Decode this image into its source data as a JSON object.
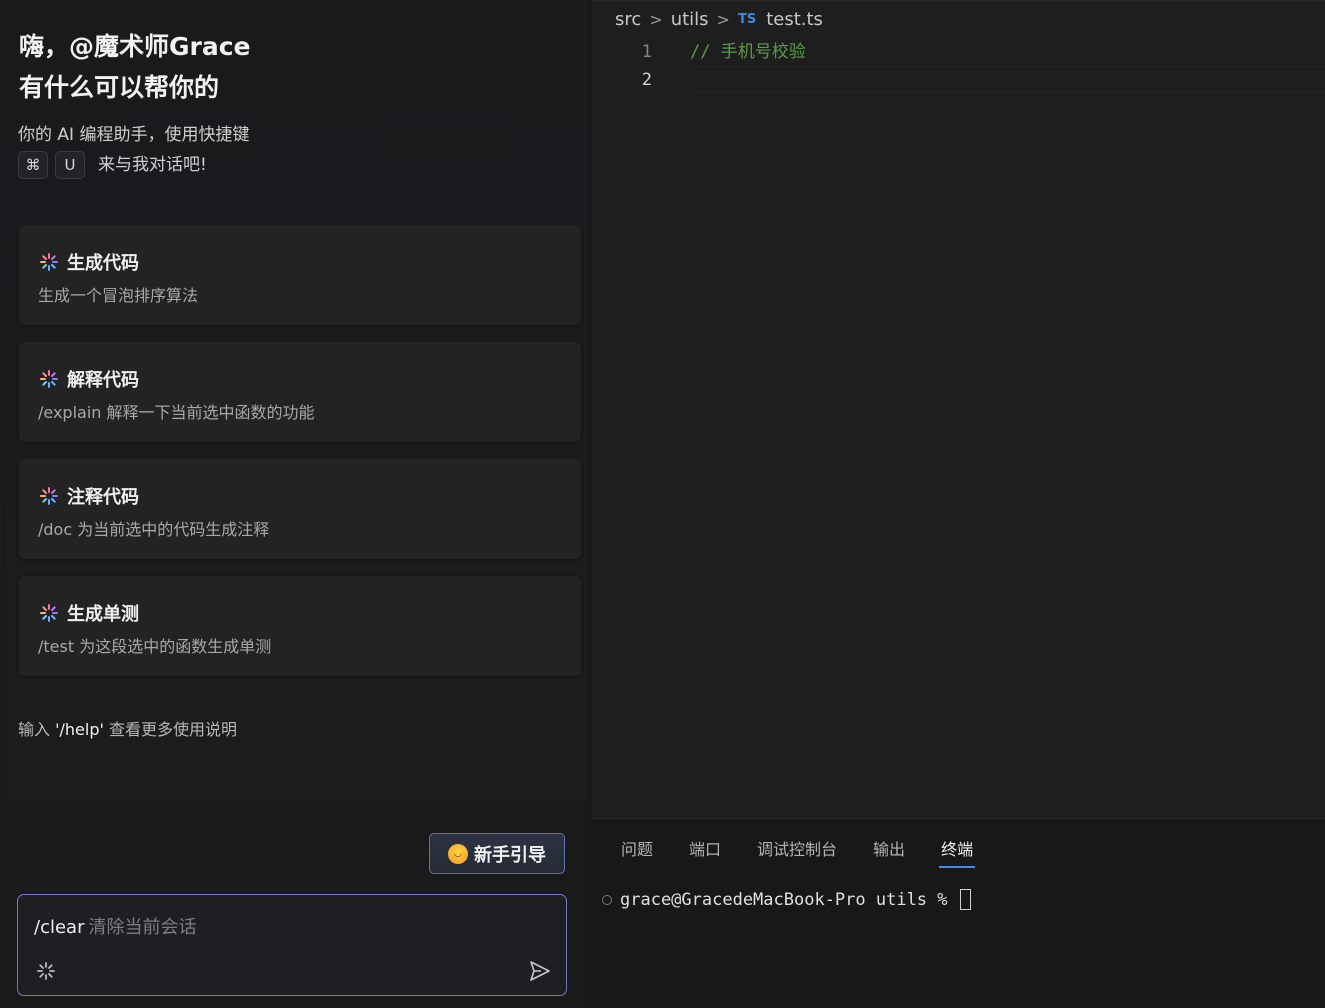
{
  "assistant": {
    "greeting_line1": "嗨，@魔术师Grace",
    "greeting_line2": "有什么可以帮你的",
    "subtitle": "你的 AI 编程助手，使用快捷键",
    "shortcut_keys": [
      "⌘",
      "U"
    ],
    "shortcut_suffix": "来与我对话吧!",
    "cards": [
      {
        "title": "生成代码",
        "desc": "生成一个冒泡排序算法"
      },
      {
        "title": "解释代码",
        "desc": "/explain 解释一下当前选中函数的功能"
      },
      {
        "title": "注释代码",
        "desc": "/doc 为当前选中的代码生成注释"
      },
      {
        "title": "生成单测",
        "desc": "/test 为这段选中的函数生成单测"
      }
    ],
    "help_prefix": "输入 ",
    "help_cmd": "'/help'",
    "help_suffix": " 查看更多使用说明",
    "guide_button": "新手引导",
    "input": {
      "command": "/clear",
      "hint": "清除当前会话"
    }
  },
  "editor": {
    "breadcrumb": [
      "src",
      "utils"
    ],
    "file_badge": "TS",
    "file_name": "test.ts",
    "line_numbers": [
      "1",
      "2"
    ],
    "code_line_1": "// 手机号校验"
  },
  "panel": {
    "tabs": [
      "问题",
      "端口",
      "调试控制台",
      "输出",
      "终端"
    ],
    "active_tab": "终端",
    "terminal_prompt": "grace@GracedeMacBook-Pro utils %"
  },
  "colors": {
    "accent_tab": "#3b8eea",
    "input_border": "#7a73c9",
    "comment": "#5a9a4a"
  }
}
